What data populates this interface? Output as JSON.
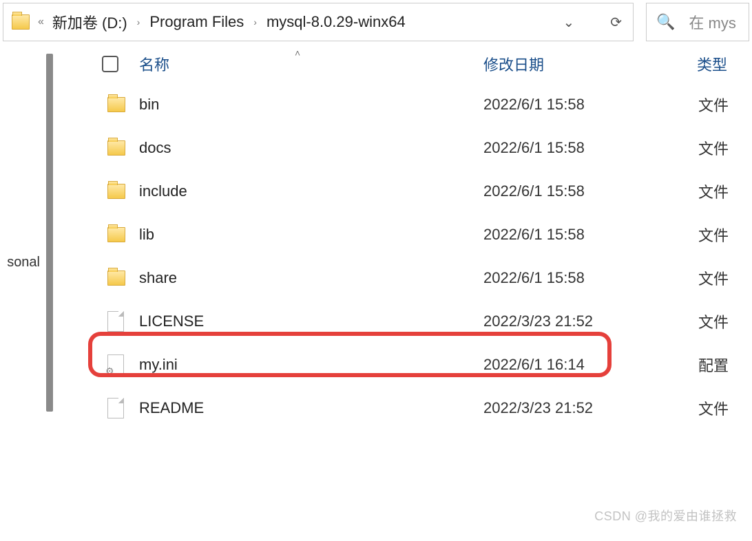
{
  "address": {
    "overflow": "«",
    "segments": [
      "新加卷 (D:)",
      "Program Files",
      "mysql-8.0.29-winx64"
    ],
    "sep": "›"
  },
  "search": {
    "placeholder_prefix": "在 mys"
  },
  "nav": {
    "truncated_item": "sonal"
  },
  "columns": {
    "name": "名称",
    "modified": "修改日期",
    "type": "类型"
  },
  "rows": [
    {
      "kind": "folder",
      "name": "bin",
      "modified": "2022/6/1 15:58",
      "type": "文件"
    },
    {
      "kind": "folder",
      "name": "docs",
      "modified": "2022/6/1 15:58",
      "type": "文件"
    },
    {
      "kind": "folder",
      "name": "include",
      "modified": "2022/6/1 15:58",
      "type": "文件"
    },
    {
      "kind": "folder",
      "name": "lib",
      "modified": "2022/6/1 15:58",
      "type": "文件"
    },
    {
      "kind": "folder",
      "name": "share",
      "modified": "2022/6/1 15:58",
      "type": "文件"
    },
    {
      "kind": "file",
      "name": "LICENSE",
      "modified": "2022/3/23 21:52",
      "type": "文件"
    },
    {
      "kind": "config",
      "name": "my.ini",
      "modified": "2022/6/1 16:14",
      "type": "配置"
    },
    {
      "kind": "file",
      "name": "README",
      "modified": "2022/3/23 21:52",
      "type": "文件"
    }
  ],
  "watermark": "CSDN @我的爱由谁拯救"
}
